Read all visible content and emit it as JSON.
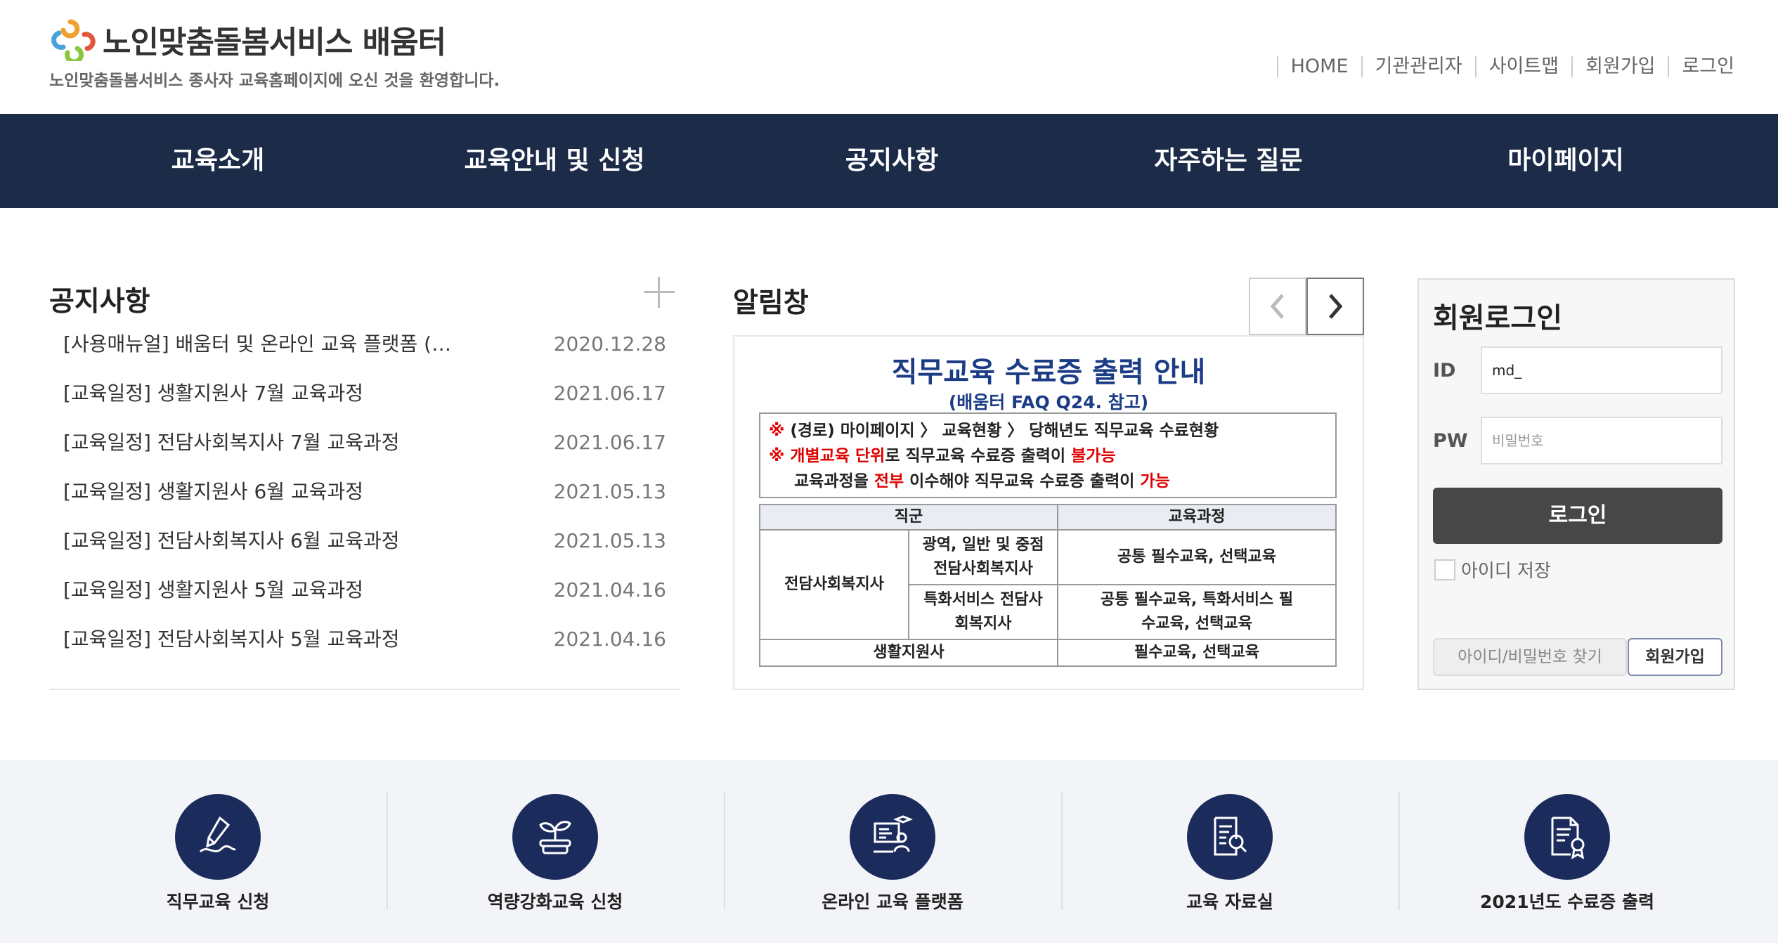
{
  "header": {
    "logo_title": "노인맞춤돌봄서비스 배움터",
    "tagline": "노인맞춤돌봄서비스 종사자 교육홈페이지에 오신 것을 환영합니다.",
    "utility": [
      "HOME",
      "기관관리자",
      "사이트맵",
      "회원가입",
      "로그인"
    ]
  },
  "gnb": [
    "교육소개",
    "교육안내 및 신청",
    "공지사항",
    "자주하는 질문",
    "마이페이지"
  ],
  "notice": {
    "title": "공지사항",
    "items": [
      {
        "title": "[사용매뉴얼] 배움터 및 온라인 교육 플랫폼 (…",
        "date": "2020.12.28"
      },
      {
        "title": "[교육일정] 생활지원사 7월 교육과정",
        "date": "2021.06.17"
      },
      {
        "title": "[교육일정] 전담사회복지사 7월 교육과정",
        "date": "2021.06.17"
      },
      {
        "title": "[교육일정] 생활지원사 6월 교육과정",
        "date": "2021.05.13"
      },
      {
        "title": "[교육일정] 전담사회복지사 6월 교육과정",
        "date": "2021.05.13"
      },
      {
        "title": "[교육일정] 생활지원사 5월 교육과정",
        "date": "2021.04.16"
      },
      {
        "title": "[교육일정] 전담사회복지사 5월 교육과정",
        "date": "2021.04.16"
      }
    ]
  },
  "alert": {
    "title": "알림창",
    "banner_title": "직무교육 수료증 출력 안내",
    "banner_sub": "(배움터 FAQ Q24. 참고)",
    "note_line1_mark": "※ ",
    "note_line1": "(경로) 마이페이지 〉 교육현황 〉 당해년도 직무교육 수료현황",
    "note_line2_mark": "※ 개별교육 단위",
    "note_line2_mid": "로 직무교육 수료증 출력이 ",
    "note_line2_red": "불가능",
    "note_line3_a": "교육과정을 ",
    "note_line3_red1": "전부",
    "note_line3_b": " 이수해야 직무교육 수료증 출력이 ",
    "note_line3_red2": "가능",
    "table": {
      "head_group": "직군",
      "head_course": "교육과정",
      "group_a": "전담사회복지사",
      "row1_sub": "광역, 일반 및 중점 전담사회복지사",
      "row1_course": "공통 필수교육, 선택교육",
      "row2_sub": "특화서비스 전담사회복지사",
      "row2_course": "공통 필수교육, 특화서비스 필수교육, 선택교육",
      "row3_group": "생활지원사",
      "row3_course": "필수교육, 선택교육"
    }
  },
  "login": {
    "title": "회원로그인",
    "id_label": "ID",
    "id_value": "md_",
    "pw_label": "PW",
    "pw_placeholder": "비밀번호",
    "login_button": "로그인",
    "save_id": "아이디 저장",
    "find_button": "아이디/비밀번호 찾기",
    "join_button": "회원가입"
  },
  "quick": [
    {
      "label": "직무교육 신청",
      "icon": "pen-signature-icon"
    },
    {
      "label": "역량강화교육 신청",
      "icon": "sprout-icon"
    },
    {
      "label": "온라인 교육 플랫폼",
      "icon": "online-lecture-icon"
    },
    {
      "label": "교육 자료실",
      "icon": "document-search-icon"
    },
    {
      "label": "2021년도 수료증 출력",
      "icon": "certificate-icon"
    }
  ],
  "colors": {
    "navy": "#1b2b48",
    "icon_navy": "#1b2b5c",
    "banner_blue": "#1c3d86",
    "red": "#e00000"
  }
}
